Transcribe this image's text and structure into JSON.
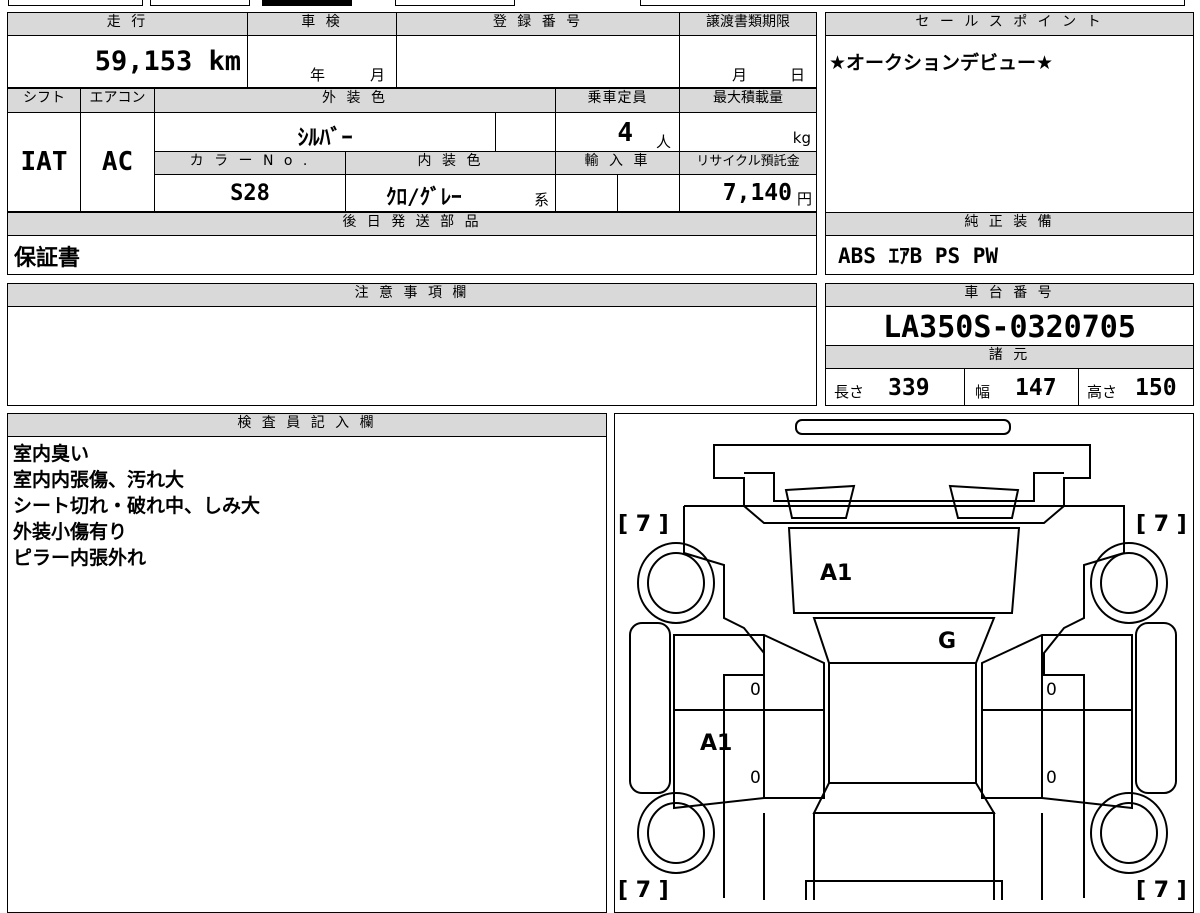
{
  "row1": {
    "mileage_label": "走 行",
    "mileage_value": "59,153 km",
    "inspection_label": "車 検",
    "year_unit": "年",
    "month_unit": "月",
    "registration_label": "登 録 番 号",
    "transfer_label": "譲渡書類期限",
    "transfer_month": "月",
    "transfer_day": "日"
  },
  "sales_point": {
    "label": "セ ー ル ス ポ イ ン ト",
    "text": "★オークションデビュー★"
  },
  "row2": {
    "shift_label": "シフト",
    "shift_value": "IAT",
    "ac_label": "エアコン",
    "ac_value": "AC",
    "exterior_color_label": "外 装 色",
    "exterior_color_value": "ｼﾙﾊﾞｰ",
    "capacity_label": "乗車定員",
    "capacity_value": "4",
    "capacity_unit": "人",
    "max_load_label": "最大積載量",
    "max_load_unit": "kg",
    "color_no_label": "カ ラ ー N o .",
    "color_no_value": "S28",
    "interior_color_label": "内 装 色",
    "interior_color_value": "ｸﾛ/ｸﾞﾚｰ",
    "interior_suffix": "系",
    "import_label": "輸 入 車",
    "recycle_label": "リサイクル預託金",
    "recycle_value": "7,140",
    "recycle_unit": "円"
  },
  "later_parts": {
    "label": "後 日 発 送 部 品",
    "value": "保証書"
  },
  "genuine_equipment": {
    "label": "純 正 装 備",
    "value": "ABS ｴｱB PS PW"
  },
  "notes": {
    "label": "注 意 事 項 欄",
    "value": ""
  },
  "chassis": {
    "label": "車 台 番 号",
    "value": "LA350S-0320705",
    "specs_label": "諸 元",
    "length_label": "長さ",
    "length_value": "339",
    "width_label": "幅",
    "width_value": "147",
    "height_label": "高さ",
    "height_value": "150"
  },
  "inspector": {
    "label": "検 査 員 記 入 欄",
    "lines": [
      "室内臭い",
      "室内内張傷、汚れ大",
      "シート切れ・破れ中、しみ大",
      "外装小傷有り",
      "ピラー内張外れ"
    ]
  },
  "diagram": {
    "tire_marks": [
      "[ 7 ]",
      "[ 7 ]",
      "[ 7 ]",
      "[ 7 ]"
    ],
    "hood_mark": "A1",
    "windshield_mark": "G",
    "left_rear_door_mark": "A1",
    "left_front_door_value": "0",
    "left_rear_door_value": "0",
    "right_front_door_value": "0",
    "right_rear_door_value": "0"
  }
}
